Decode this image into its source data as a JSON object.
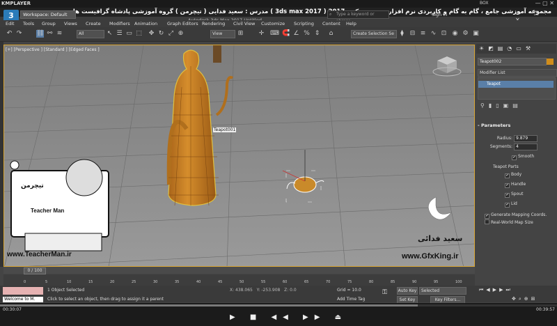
{
  "player": {
    "name": "KMPLAYER",
    "box_label": "BOX",
    "window_controls": "— ▢ ✕",
    "header_text": "مجموعه آموزشی جامع ، گام به گام و کاربردی نرم افزار تری دی مکس 2017  ( 3ds max 2017 )  مدرس : سعید فدایی ( تیچرمن ) گروه آموزشی پادشاه گرافیست ها",
    "time_elapsed": "00:30:07",
    "time_total": "00:39:57",
    "progress_fraction": 0.75,
    "controls": "▶ ■ ◀◀ ▶▶ ⏏"
  },
  "app": {
    "logo_text": "3",
    "logo_sub": "MAX",
    "workspace": "Workspace: Default",
    "title": "Autodesk 3ds Max 2017    Untitled",
    "search_placeholder": "Type a keyword or phrase",
    "sign_in": "Sign In",
    "window_controls": "— ❐ ✕"
  },
  "menu": [
    "Edit",
    "Tools",
    "Group",
    "Views",
    "Create",
    "Modifiers",
    "Animation",
    "Graph Editors",
    "Rendering",
    "Civil View",
    "Customize",
    "Scripting",
    "Content",
    "Help"
  ],
  "toolbar": {
    "filter": "All",
    "ref_coord": "View",
    "selection_set": "Create Selection Se"
  },
  "viewport": {
    "label": "[+] [Perspective ] [Standard ] [Edged Faces ]",
    "object_label": "Teapot001",
    "selection_color": "#d9a531",
    "object_color": "#d18d1b"
  },
  "watermarks": {
    "teacher_site": "www.TeacherMan.ir",
    "teacher_name": "Teacher Man",
    "teacher_brand": "تیچرمن",
    "author": "سعید فدائی",
    "gfx_site": "www.GfxKing.ir"
  },
  "command_panel": {
    "object_name": "Teapot002",
    "modifier_list": "Modifier List",
    "stack_item": "Teapot",
    "parameters_title": "Parameters",
    "radius_label": "Radius:",
    "radius_value": "9.879",
    "segments_label": "Segments:",
    "segments_value": "4",
    "smooth": "Smooth",
    "parts_title": "Teapot Parts",
    "body": "Body",
    "handle": "Handle",
    "spout": "Spout",
    "lid": "Lid",
    "gen_mapping": "Generate Mapping Coords.",
    "real_world": "Real-World Map Size"
  },
  "timeline": {
    "slider": "0 / 100",
    "ticks": [
      "0",
      "5",
      "10",
      "15",
      "20",
      "25",
      "30",
      "35",
      "40",
      "45",
      "50",
      "55",
      "60",
      "65",
      "70",
      "75",
      "80",
      "85",
      "90",
      "95",
      "100"
    ]
  },
  "status": {
    "selected": "1 Object Selected",
    "prompt": "Click to select an object, then drag to assign it a parent",
    "x": "X: 438.065",
    "y": "Y: -253.908",
    "z": "Z: 0.0",
    "grid": "Grid = 10.0",
    "add_time_tag": "Add Time Tag",
    "auto_key": "Auto Key",
    "set_key": "Set Key",
    "selected_dropdown": "Selected",
    "key_filters": "Key Filters...",
    "welcome": "Welcome to M."
  }
}
